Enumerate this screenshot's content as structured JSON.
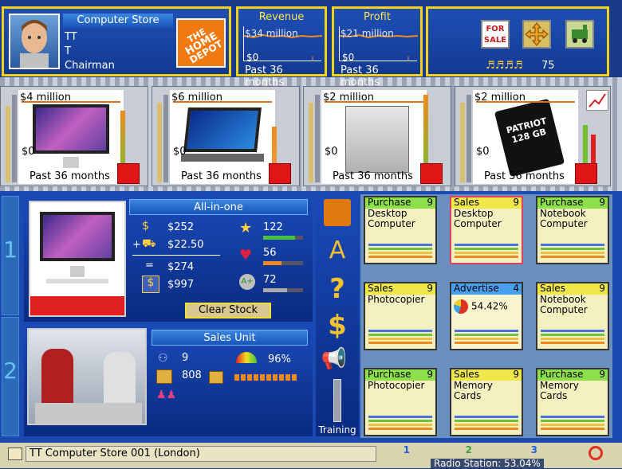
{
  "store": {
    "type_label": "Computer Store",
    "manager_name": "TT",
    "manager_initial": "T",
    "manager_title": "Chairman",
    "logo_text": "THE HOME DEPOT"
  },
  "revenue": {
    "title": "Revenue",
    "max_label": "$34 million",
    "min_label": "$0",
    "period": "Past 36 months"
  },
  "profit": {
    "title": "Profit",
    "max_label": "$21 million",
    "min_label": "$0",
    "period": "Past 36 months"
  },
  "top_right": {
    "for_sale_label": "FOR SALE",
    "staff_count": "75"
  },
  "products": [
    {
      "name": "Desktop",
      "max_label": "$4 million",
      "min_label": "$0",
      "period": "Past 36 months"
    },
    {
      "name": "Notebook",
      "max_label": "$6 million",
      "min_label": "$0",
      "period": "Past 36 months"
    },
    {
      "name": "Photocopier",
      "max_label": "$2 million",
      "min_label": "$0",
      "period": "Past 36 months"
    },
    {
      "name": "Memory Card",
      "max_label": "$2 million",
      "min_label": "$0",
      "period": "Past 36 months",
      "card_text": "PATRIOT 128 GB"
    }
  ],
  "product_detail": {
    "title": "All-in-one",
    "cost": "$252",
    "extra": "$22.50",
    "total": "$274",
    "price": "$997",
    "quality": "122",
    "appeal": "56",
    "rating": "72",
    "clear_stock_label": "Clear Stock",
    "quality_level": 0.8,
    "appeal_level": 0.45,
    "rating_level": 0.6
  },
  "sales_unit": {
    "title": "Sales Unit",
    "staff": "9",
    "stock": "808",
    "satisfaction": "96%"
  },
  "side_buttons": {
    "training_label": "Training"
  },
  "tasks": [
    {
      "type": "Purchase",
      "count": "9",
      "line1": "Desktop",
      "line2": "Computer",
      "color": "#8ee04a"
    },
    {
      "type": "Sales",
      "count": "9",
      "line1": "Desktop",
      "line2": "Computer",
      "color": "#f0e84a"
    },
    {
      "type": "Purchase",
      "count": "9",
      "line1": "Notebook",
      "line2": "Computer",
      "color": "#8ee04a"
    },
    {
      "type": "Sales",
      "count": "9",
      "line1": "Photocopier",
      "line2": "",
      "color": "#f0e84a"
    },
    {
      "type": "Advertise",
      "count": "4",
      "line1": "54.42%",
      "line2": "",
      "color": "#4aa0f0"
    },
    {
      "type": "Sales",
      "count": "9",
      "line1": "Notebook",
      "line2": "Computer",
      "color": "#f0e84a"
    },
    {
      "type": "Purchase",
      "count": "9",
      "line1": "Photocopier",
      "line2": "",
      "color": "#8ee04a"
    },
    {
      "type": "Sales",
      "count": "9",
      "line1": "Memory",
      "line2": "Cards",
      "color": "#f0e84a"
    },
    {
      "type": "Purchase",
      "count": "9",
      "line1": "Memory",
      "line2": "Cards",
      "color": "#8ee04a"
    }
  ],
  "status": {
    "firm_label": "TT Computer Store 001 (London)",
    "tab1": "1",
    "tab2": "2",
    "tab3": "3",
    "news_ticker": "Radio Station: 53.04%"
  },
  "side_tabs": {
    "tab1": "1",
    "tab2": "2"
  }
}
